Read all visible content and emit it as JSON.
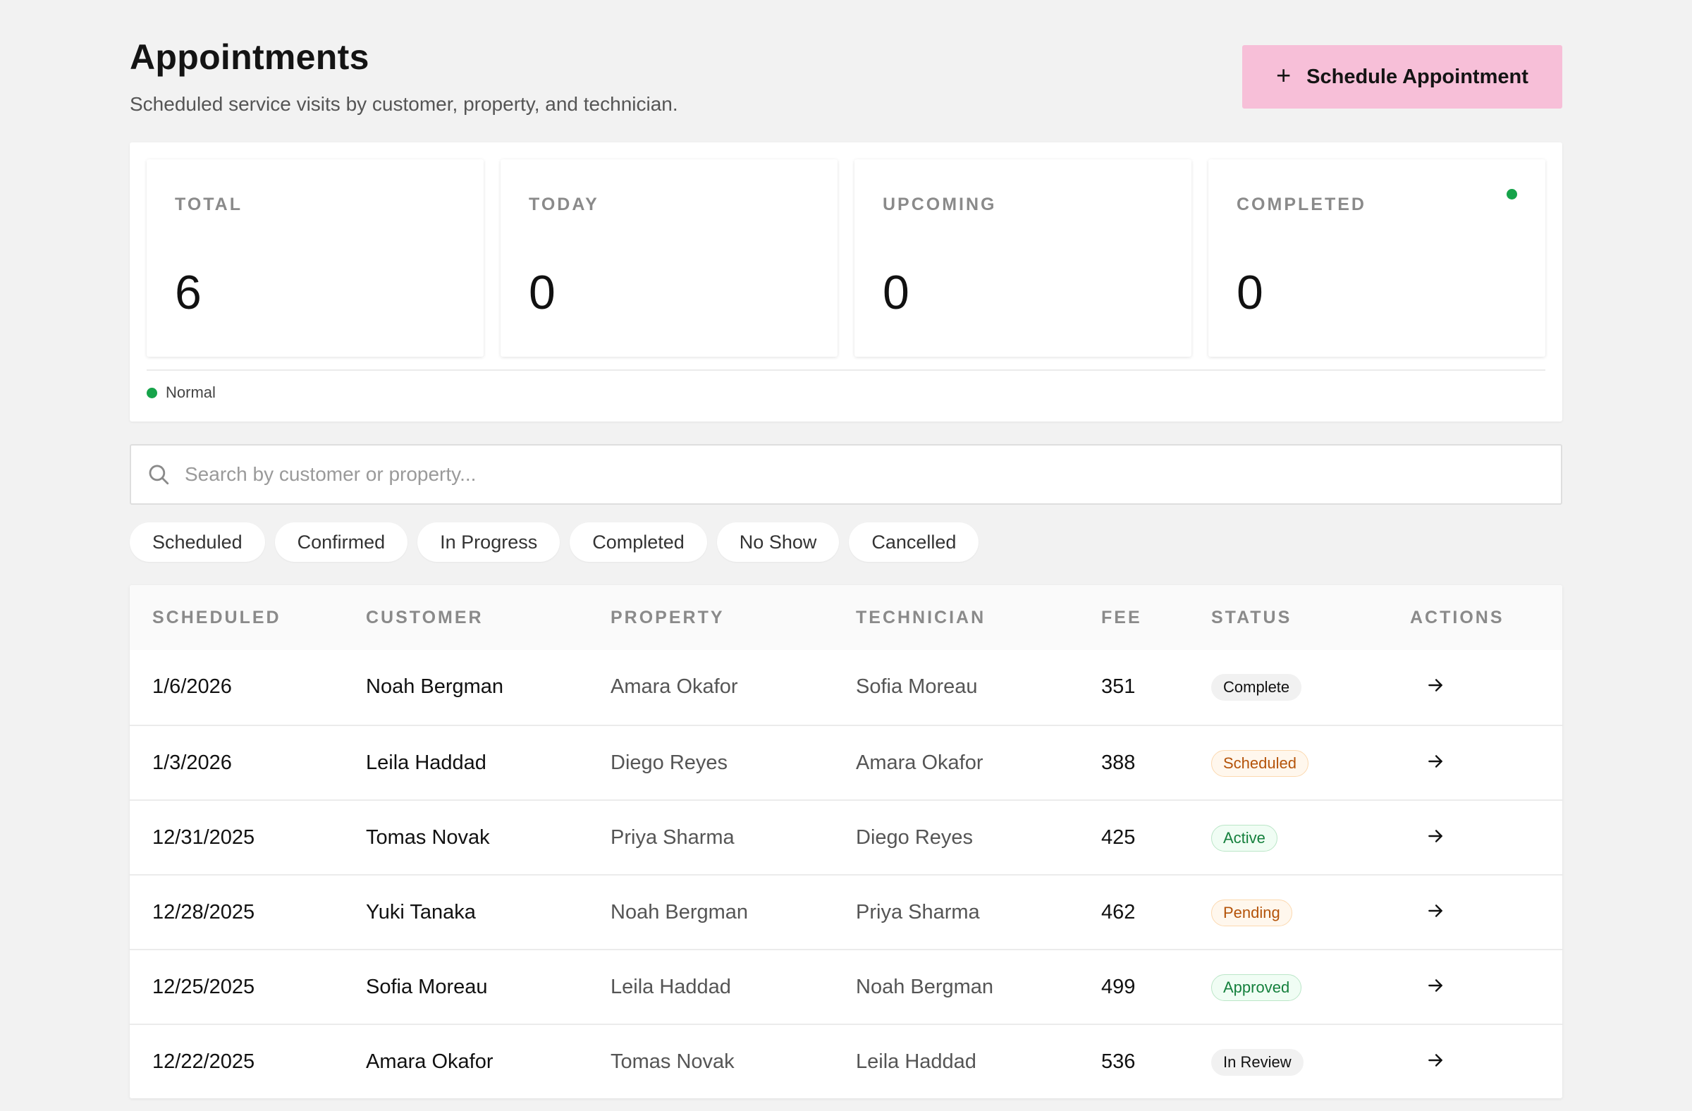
{
  "header": {
    "title": "Appointments",
    "subtitle": "Scheduled service visits by customer, property, and technician.",
    "primary_button_label": "Schedule Appointment"
  },
  "stats": [
    {
      "label": "TOTAL",
      "value": "6"
    },
    {
      "label": "TODAY",
      "value": "0"
    },
    {
      "label": "UPCOMING",
      "value": "0"
    },
    {
      "label": "COMPLETED",
      "value": "0"
    }
  ],
  "legend": {
    "label": "Normal",
    "color": "#16a34a"
  },
  "search": {
    "placeholder": "Search by customer or property...",
    "value": ""
  },
  "filters": [
    "Scheduled",
    "Confirmed",
    "In Progress",
    "Completed",
    "No Show",
    "Cancelled"
  ],
  "table": {
    "columns": [
      "SCHEDULED",
      "CUSTOMER",
      "PROPERTY",
      "TECHNICIAN",
      "FEE",
      "STATUS",
      "ACTIONS"
    ],
    "rows": [
      {
        "scheduled": "1/6/2026",
        "customer": "Noah Bergman",
        "property": "Amara Okafor",
        "technician": "Sofia Moreau",
        "fee": "351",
        "status": "Complete",
        "status_tone": "neutral"
      },
      {
        "scheduled": "1/3/2026",
        "customer": "Leila Haddad",
        "property": "Diego Reyes",
        "technician": "Amara Okafor",
        "fee": "388",
        "status": "Scheduled",
        "status_tone": "warning"
      },
      {
        "scheduled": "12/31/2025",
        "customer": "Tomas Novak",
        "property": "Priya Sharma",
        "technician": "Diego Reyes",
        "fee": "425",
        "status": "Active",
        "status_tone": "success"
      },
      {
        "scheduled": "12/28/2025",
        "customer": "Yuki Tanaka",
        "property": "Noah Bergman",
        "technician": "Priya Sharma",
        "fee": "462",
        "status": "Pending",
        "status_tone": "warning"
      },
      {
        "scheduled": "12/25/2025",
        "customer": "Sofia Moreau",
        "property": "Leila Haddad",
        "technician": "Noah Bergman",
        "fee": "499",
        "status": "Approved",
        "status_tone": "success"
      },
      {
        "scheduled": "12/22/2025",
        "customer": "Amara Okafor",
        "property": "Tomas Novak",
        "technician": "Leila Haddad",
        "fee": "536",
        "status": "In Review",
        "status_tone": "neutral"
      }
    ]
  },
  "colors": {
    "accent_button": "#f7bfd8",
    "status_dot": "#16a34a",
    "badge_neutral_bg": "#f1f1f1",
    "badge_neutral_text": "#111111",
    "badge_warning_bg": "#fff7ed",
    "badge_warning_text": "#b45309",
    "badge_warning_border": "#fcd9b0",
    "badge_success_bg": "#f0fdf4",
    "badge_success_text": "#15803d",
    "badge_success_border": "#bbe6c8"
  },
  "icons": {
    "primary_button": "plus-icon",
    "search": "search-icon",
    "row_action": "arrow-right-icon"
  }
}
